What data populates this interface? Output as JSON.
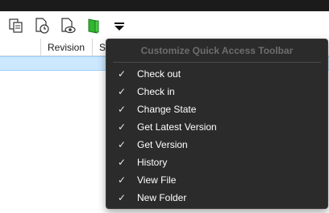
{
  "toolbar": {
    "buttons": [
      {
        "icon": "copy-files-icon"
      },
      {
        "icon": "document-history-icon"
      },
      {
        "icon": "document-view-icon"
      },
      {
        "icon": "new-folder-icon"
      },
      {
        "icon": "customize-dropdown-icon"
      }
    ]
  },
  "grid": {
    "columns": [
      "Revision",
      "St"
    ]
  },
  "menu": {
    "header": "Customize Quick Access Toolbar",
    "check_glyph": "✓",
    "items": [
      {
        "label": "Check out",
        "checked": true
      },
      {
        "label": "Check in",
        "checked": true
      },
      {
        "label": "Change State",
        "checked": true
      },
      {
        "label": "Get Latest Version",
        "checked": true
      },
      {
        "label": "Get Version",
        "checked": true
      },
      {
        "label": "History",
        "checked": true
      },
      {
        "label": "View File",
        "checked": true
      },
      {
        "label": "New Folder",
        "checked": true
      }
    ]
  },
  "colors": {
    "menu_bg": "#2b2b2b",
    "selection": "#cce8ff",
    "folder_green": "#2fb52f"
  }
}
